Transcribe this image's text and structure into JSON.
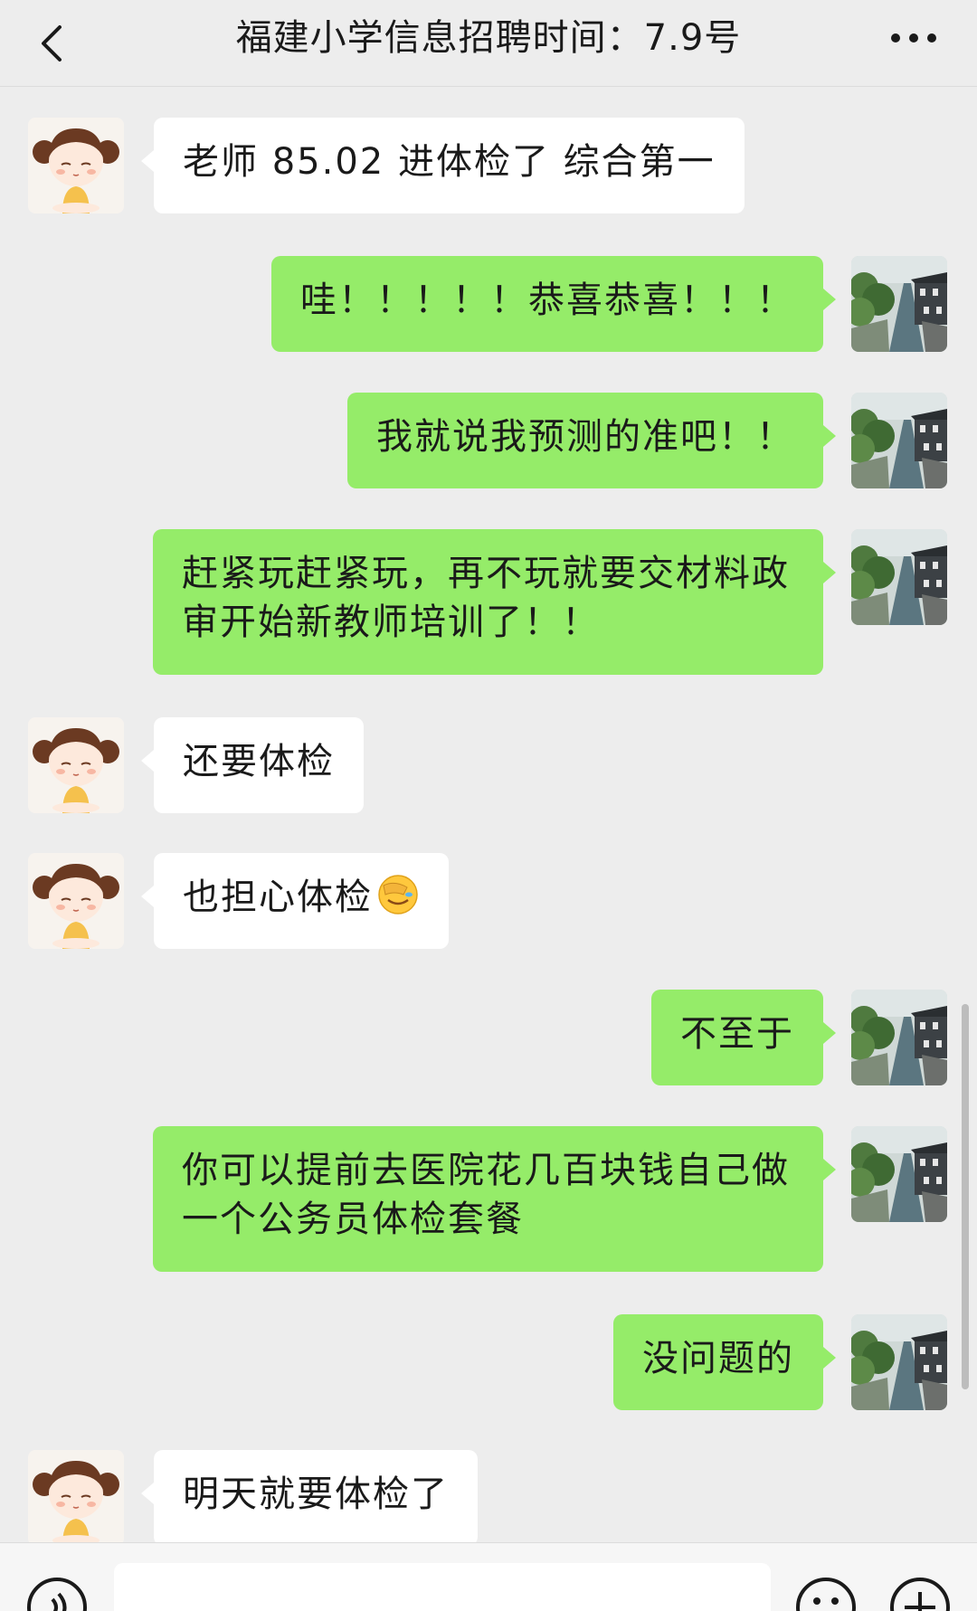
{
  "header": {
    "title": "福建小学信息招聘时间：7.9号",
    "back_icon": "chevron-left-icon",
    "more_icon": "more-dots-icon"
  },
  "colors": {
    "background": "#ededed",
    "self_bubble": "#95ec69",
    "other_bubble": "#ffffff",
    "text": "#1a1a1a"
  },
  "messages": [
    {
      "sender": "other",
      "text": "老师 85.02 进体检了 综合第一"
    },
    {
      "sender": "self",
      "text": "哇！！！！！恭喜恭喜！！！"
    },
    {
      "sender": "self",
      "text": "我就说我预测的准吧！！"
    },
    {
      "sender": "self",
      "text": "赶紧玩赶紧玩，再不玩就要交材料政审开始新教师培训了！！"
    },
    {
      "sender": "other",
      "text": "还要体检"
    },
    {
      "sender": "other",
      "text": "也担心体检",
      "emoji": "facepalm-emoji"
    },
    {
      "sender": "self",
      "text": "不至于"
    },
    {
      "sender": "self",
      "text": "你可以提前去医院花几百块钱自己做一个公务员体检套餐"
    },
    {
      "sender": "self",
      "text": "没问题的"
    },
    {
      "sender": "other",
      "text": "明天就要体检了"
    }
  ],
  "input_bar": {
    "voice_icon": "voice-icon",
    "emoji_icon": "emoji-face-icon",
    "plus_icon": "plus-circle-icon",
    "input_value": ""
  }
}
